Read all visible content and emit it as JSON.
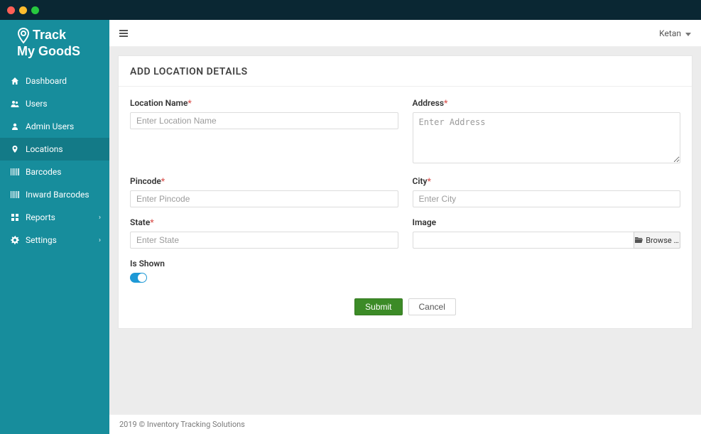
{
  "brand": {
    "line1": "Track",
    "line2": "My GoodS"
  },
  "sidebar": {
    "items": [
      {
        "label": "Dashboard",
        "icon": "home"
      },
      {
        "label": "Users",
        "icon": "users"
      },
      {
        "label": "Admin Users",
        "icon": "user"
      },
      {
        "label": "Locations",
        "icon": "pin",
        "active": true
      },
      {
        "label": "Barcodes",
        "icon": "barcode"
      },
      {
        "label": "Inward Barcodes",
        "icon": "barcode"
      },
      {
        "label": "Reports",
        "icon": "grid",
        "expandable": true
      },
      {
        "label": "Settings",
        "icon": "gear",
        "expandable": true
      }
    ]
  },
  "topbar": {
    "username": "Ketan"
  },
  "form": {
    "header": "ADD LOCATION DETAILS",
    "labels": {
      "location_name": "Location Name",
      "address": "Address",
      "pincode": "Pincode",
      "city": "City",
      "state": "State",
      "image": "Image",
      "is_shown": "Is Shown"
    },
    "placeholders": {
      "location_name": "Enter Location Name",
      "address": "Enter Address",
      "pincode": "Enter Pincode",
      "city": "Enter City",
      "state": "Enter State"
    },
    "browse_label": "Browse …",
    "is_shown_value": true,
    "submit_label": "Submit",
    "cancel_label": "Cancel"
  },
  "footer": {
    "copyright": "2019 © Inventory Tracking Solutions"
  }
}
